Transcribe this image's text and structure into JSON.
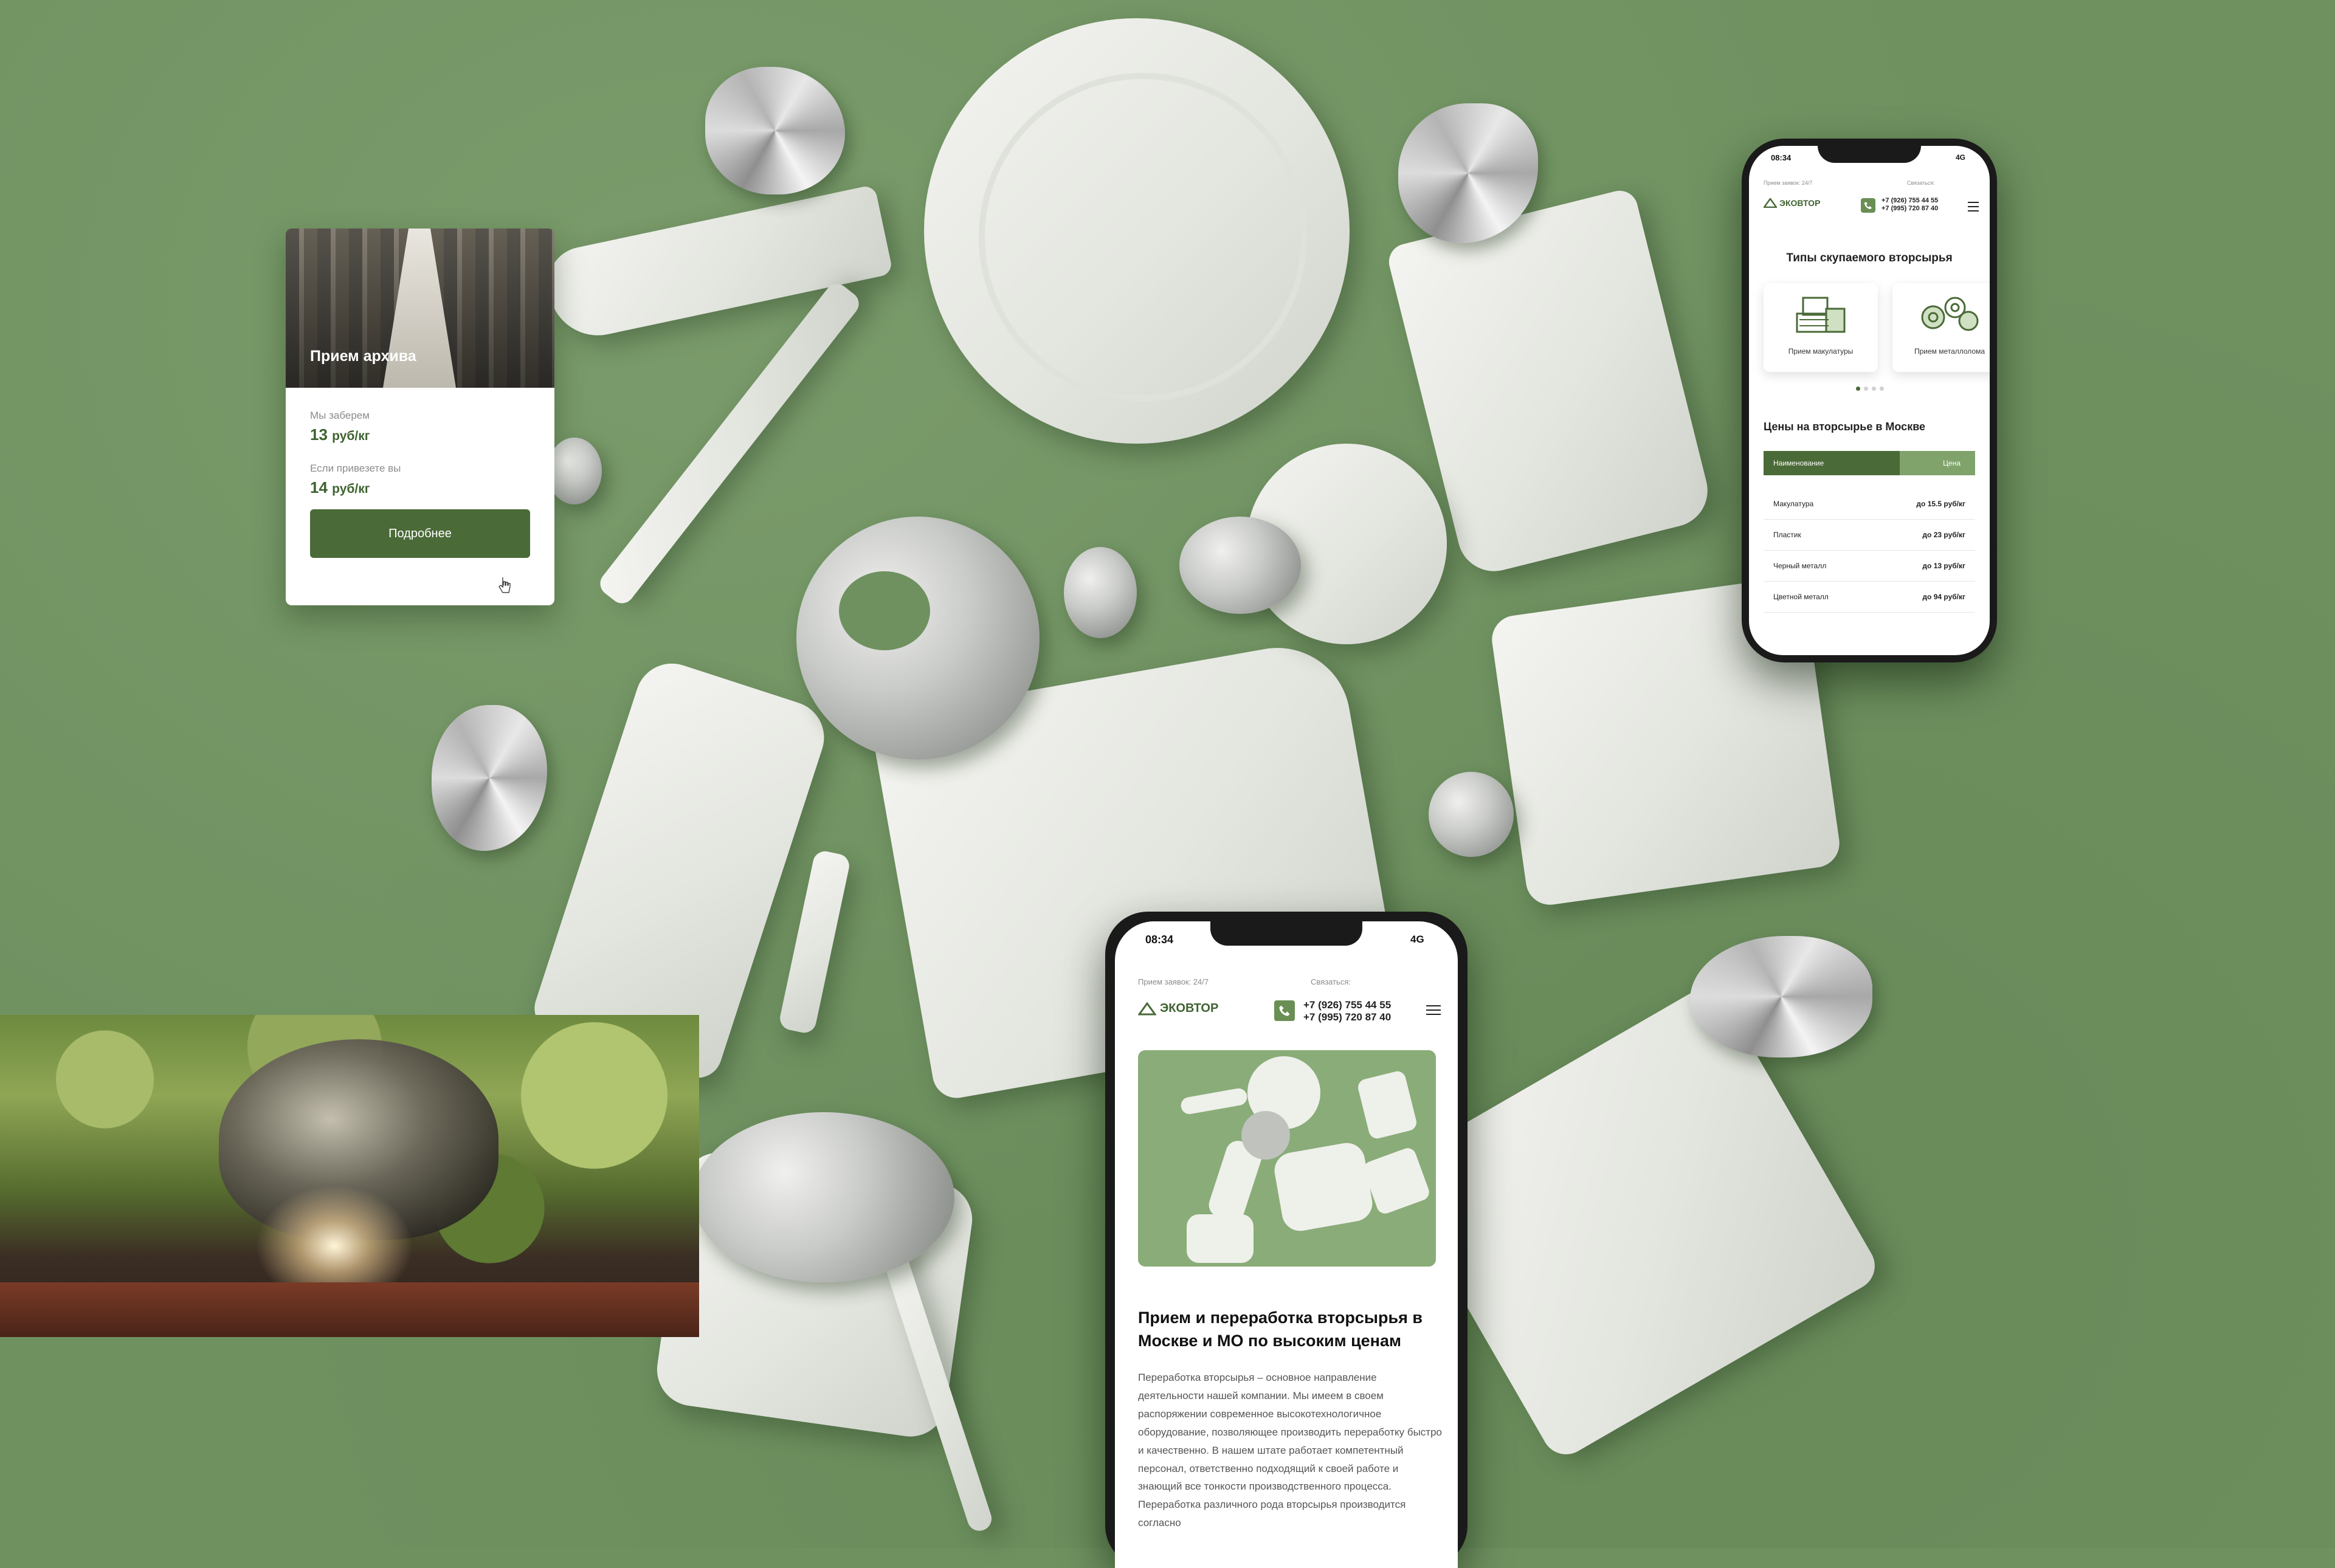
{
  "colors": {
    "background": "#6f9160",
    "accent": "#4a6a37",
    "accent_light": "#6a8f54",
    "price_text": "#3f6230"
  },
  "archive_card": {
    "title": "Прием архива",
    "pickup_label": "Мы заберем",
    "pickup_price": "13",
    "pickup_unit": "руб/кг",
    "dropoff_label": "Если привезете вы",
    "dropoff_price": "14",
    "dropoff_unit": "руб/кг",
    "button": "Подробнее"
  },
  "phone_top": {
    "status_time": "08:34",
    "status_net": "4G",
    "topbar_left": "Прием заявок: 24/7",
    "topbar_right": "Связаться:",
    "logo": "ЭКОВТОР",
    "phone_1": "+7 (926) 755 44 55",
    "phone_2": "+7 (995) 720 87 40",
    "types_title": "Типы скупаемого вторсырья",
    "tiles": [
      {
        "label": "Прием макулатуры",
        "icon": "paper-stack-icon"
      },
      {
        "label": "Прием металлолома",
        "icon": "gears-icon"
      }
    ],
    "prices_title": "Цены на вторсырье в Москве",
    "table_headers": [
      "Наименование",
      "Цена"
    ],
    "table_rows": [
      {
        "name": "Макулатура",
        "price": "до 15.5",
        "unit": "руб/кг"
      },
      {
        "name": "Пластик",
        "price": "до 23",
        "unit": "руб/кг"
      },
      {
        "name": "Черный металл",
        "price": "до 13",
        "unit": "руб/кг"
      },
      {
        "name": "Цветной металл",
        "price": "до 94",
        "unit": "руб/кг"
      }
    ]
  },
  "phone_bottom": {
    "status_time": "08:34",
    "status_net": "4G",
    "topbar_left": "Прием заявок: 24/7",
    "topbar_right": "Связаться:",
    "logo": "ЭКОВТОР",
    "phone_1": "+7 (926) 755 44 55",
    "phone_2": "+7 (995) 720 87 40",
    "hero_title": "Прием и переработка вторсырья в Москве и МО по высоким ценам",
    "hero_text": "Переработка вторсырья – основное направление деятельности нашей компании. Мы имеем в своем распоряжении современное высокотехнологичное оборудование, позволяющее производить переработку быстро и качественно. В нашем штате работает компетентный персонал, ответственно подходящий к своей работе и знающий все тонкости производственного процесса. Переработка различного рода вторсырья производится согласно"
  }
}
